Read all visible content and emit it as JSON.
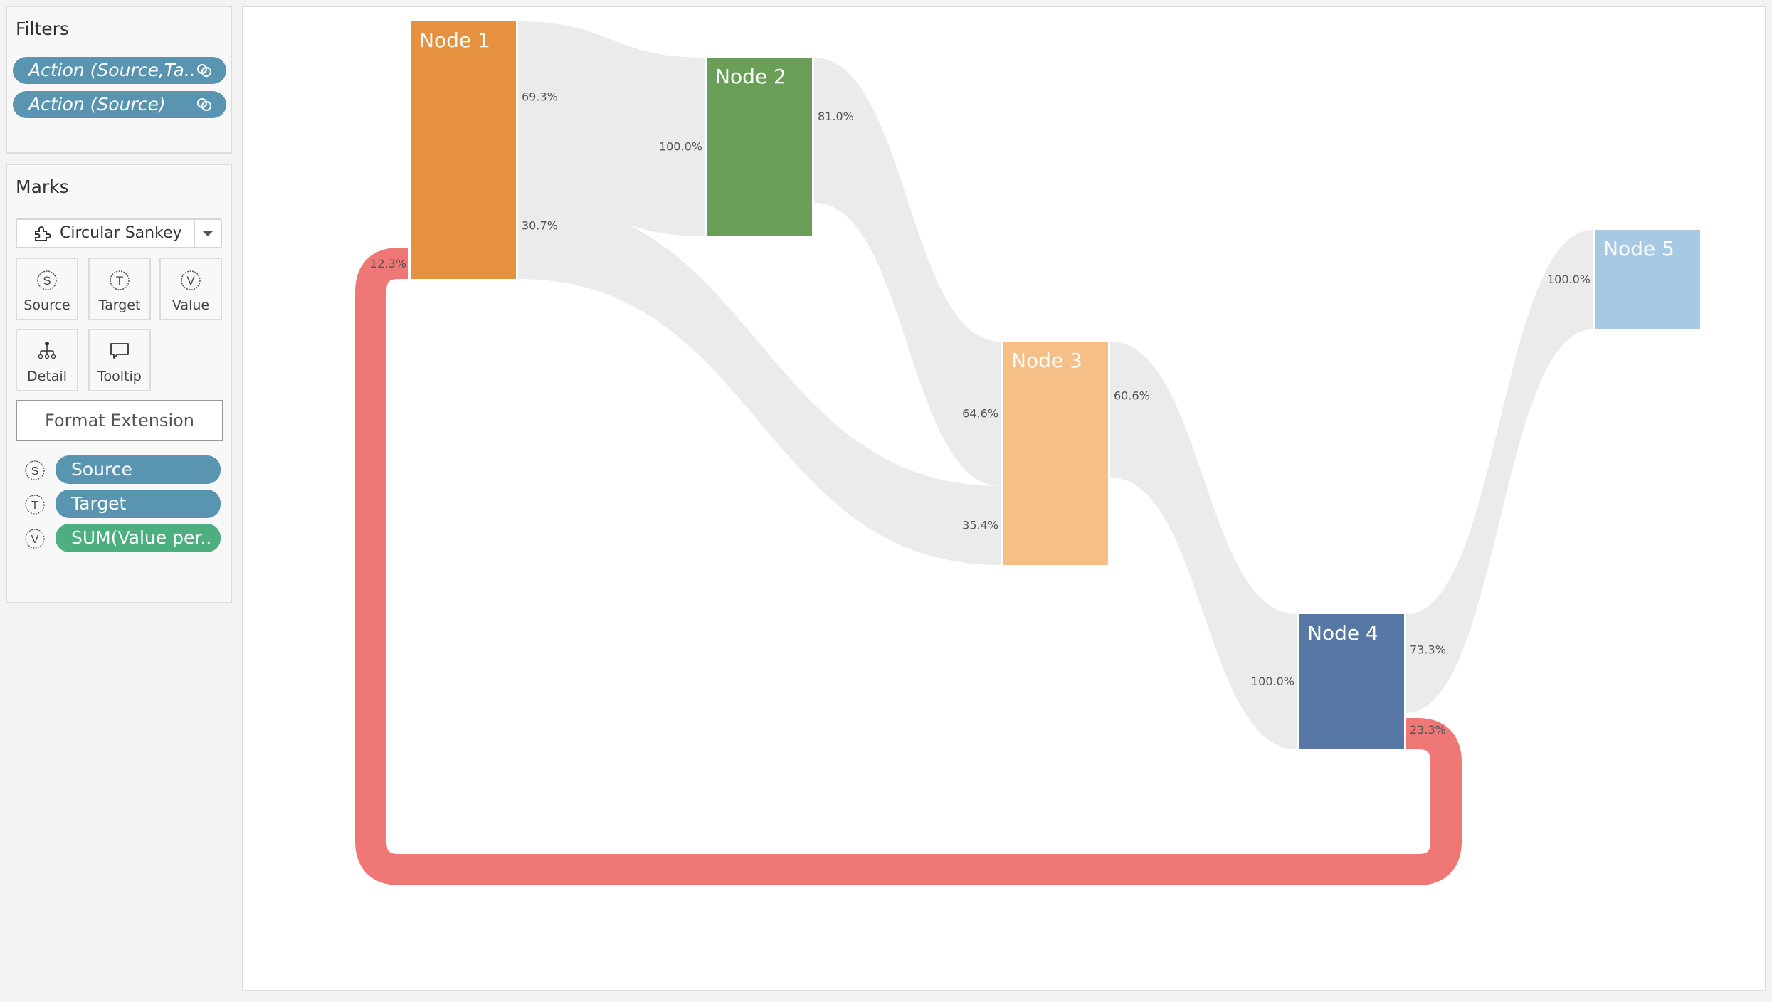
{
  "filters": {
    "title": "Filters",
    "items": [
      {
        "label": "Action (Source,Ta..",
        "icon": "linked-rings-icon"
      },
      {
        "label": "Action (Source)",
        "icon": "linked-rings-icon"
      }
    ]
  },
  "marks": {
    "title": "Marks",
    "mark_type": {
      "label": "Circular Sankey",
      "icon": "puzzle-extension-icon"
    },
    "shelves": [
      {
        "label": "Source",
        "icon": "source-s-icon"
      },
      {
        "label": "Target",
        "icon": "target-t-icon"
      },
      {
        "label": "Value",
        "icon": "value-v-icon"
      },
      {
        "label": "Detail",
        "icon": "detail-hierarchy-icon"
      },
      {
        "label": "Tooltip",
        "icon": "tooltip-speech-icon"
      }
    ],
    "format_button": "Format Extension",
    "encodings": [
      {
        "letter": "S",
        "label": "Source",
        "color": "#5994b1"
      },
      {
        "letter": "T",
        "label": "Target",
        "color": "#5994b1"
      },
      {
        "letter": "V",
        "label": "SUM(Value per..",
        "color": "#4daf7f"
      }
    ]
  },
  "chart_data": {
    "type": "sankey",
    "variant": "circular",
    "title": "",
    "nodes": [
      {
        "name": "Node 1",
        "color": "#e5913f",
        "column": 0
      },
      {
        "name": "Node 2",
        "color": "#6a9f58",
        "column": 1
      },
      {
        "name": "Node 3",
        "color": "#f5bf87",
        "column": 2
      },
      {
        "name": "Node 4",
        "color": "#5778a4",
        "column": 3
      },
      {
        "name": "Node 5",
        "color": "#a8c9e4",
        "column": 4
      }
    ],
    "links": [
      {
        "source": "Node 1",
        "target": "Node 2",
        "source_pct": "69.3%",
        "target_pct": "100.0%",
        "color": "#ebebeb"
      },
      {
        "source": "Node 1",
        "target": "Node 3",
        "source_pct": "30.7%",
        "target_pct": "35.4%",
        "color": "#ebebeb"
      },
      {
        "source": "Node 2",
        "target": "Node 3",
        "source_pct": "81.0%",
        "target_pct": "64.6%",
        "color": "#ebebeb"
      },
      {
        "source": "Node 3",
        "target": "Node 4",
        "source_pct": "60.6%",
        "target_pct": "100.0%",
        "color": "#ebebeb"
      },
      {
        "source": "Node 4",
        "target": "Node 5",
        "source_pct": "73.3%",
        "target_pct": "100.0%",
        "color": "#ebebeb"
      },
      {
        "source": "Node 4",
        "target": "Node 1",
        "source_pct": "23.3%",
        "target_pct": "12.3%",
        "color": "#ef7775",
        "circular": true
      }
    ]
  }
}
